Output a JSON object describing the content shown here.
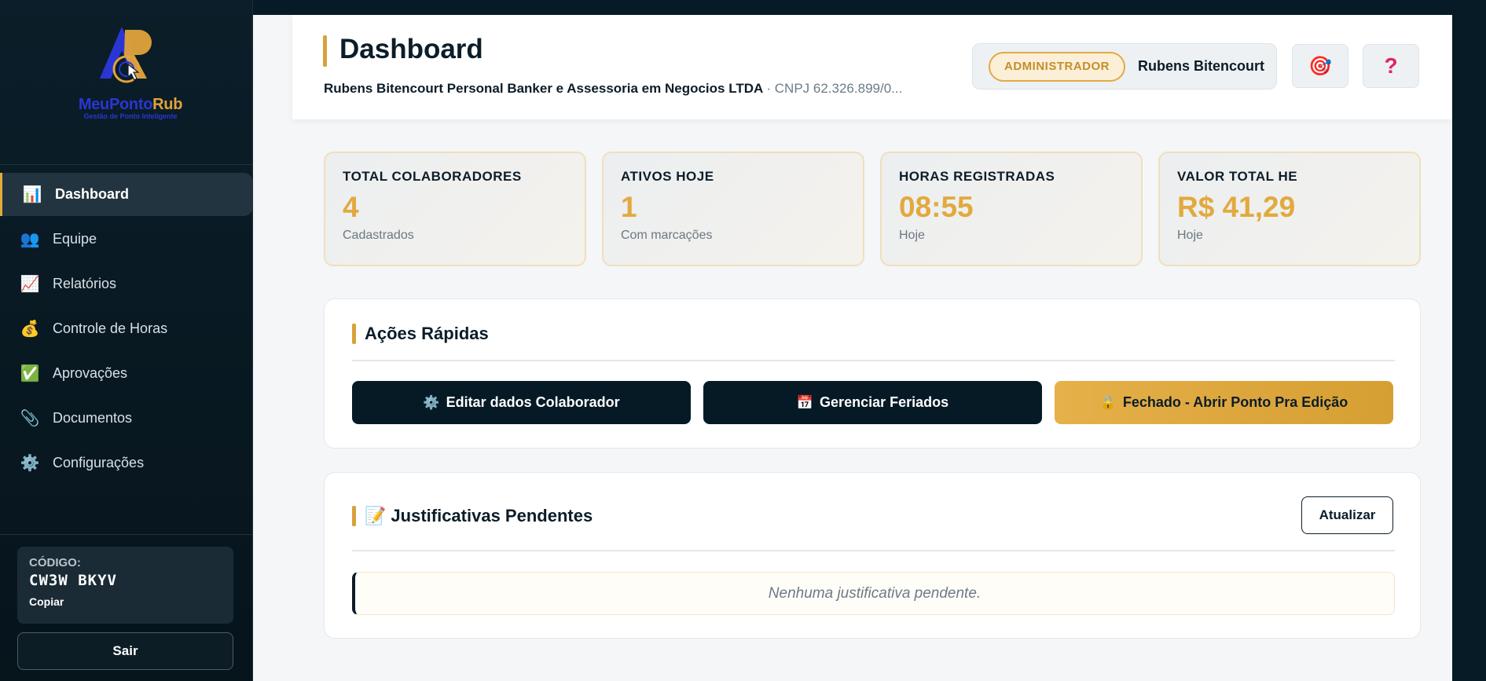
{
  "sidebar": {
    "logo": {
      "name_part1": "MeuPonto",
      "name_part2": "Rub",
      "tagline": "Gestão de Ponto Inteligente"
    },
    "items": [
      {
        "label": "Dashboard",
        "icon": "bar-chart-icon",
        "active": true
      },
      {
        "label": "Equipe",
        "icon": "team-icon"
      },
      {
        "label": "Relatórios",
        "icon": "line-chart-icon"
      },
      {
        "label": "Controle de Horas",
        "icon": "money-bag-icon"
      },
      {
        "label": "Aprovações",
        "icon": "check-icon"
      },
      {
        "label": "Documentos",
        "icon": "paperclip-icon"
      },
      {
        "label": "Configurações",
        "icon": "gear-icon"
      }
    ],
    "code": {
      "label": "CÓDIGO:",
      "value": "CW3W BKYV",
      "copy_label": "Copiar"
    },
    "logout_label": "Sair"
  },
  "header": {
    "title": "Dashboard",
    "company": "Rubens Bitencourt Personal Banker e Assessoria em Negocios LTDA",
    "cnpj": "· CNPJ 62.326.899/0...",
    "role": "ADMINISTRADOR",
    "user_name": "Rubens Bitencourt"
  },
  "stats": [
    {
      "title": "TOTAL COLABORADORES",
      "value": "4",
      "sub": "Cadastrados"
    },
    {
      "title": "ATIVOS HOJE",
      "value": "1",
      "sub": "Com marcações"
    },
    {
      "title": "HORAS REGISTRADAS",
      "value": "08:55",
      "sub": "Hoje"
    },
    {
      "title": "VALOR TOTAL HE",
      "value": "R$ 41,29",
      "sub": "Hoje"
    }
  ],
  "quick_actions": {
    "title": "Ações Rápidas",
    "buttons": [
      {
        "label": "Editar dados Colaborador",
        "icon": "gear-icon"
      },
      {
        "label": "Gerenciar Feriados",
        "icon": "calendar-icon"
      },
      {
        "label": "Fechado - Abrir Ponto Pra Edição",
        "icon": "lock-icon"
      }
    ]
  },
  "justifications": {
    "title": "Justificativas Pendentes",
    "refresh_label": "Atualizar",
    "empty_message": "Nenhuma justificativa pendente."
  },
  "colors": {
    "accent": "#e2a93f",
    "dark": "#061a26",
    "sidebar_bg": "#0b1e29"
  }
}
